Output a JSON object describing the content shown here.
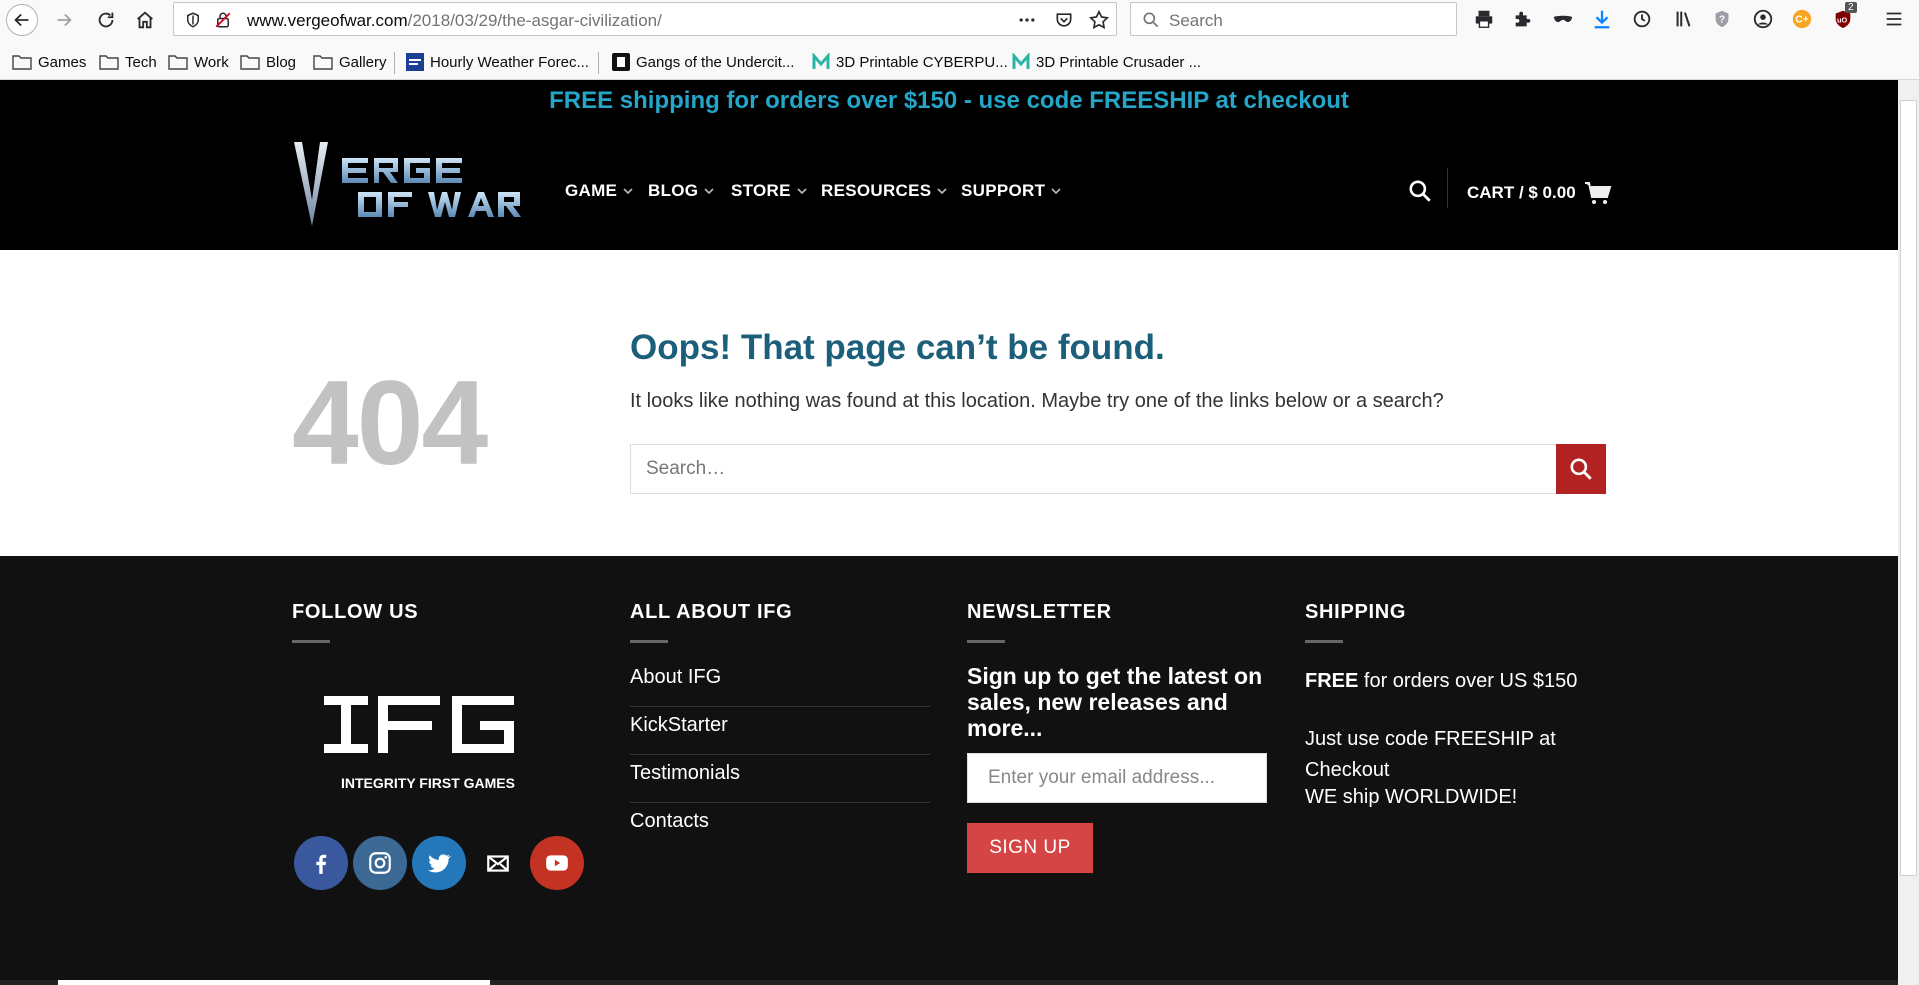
{
  "browser": {
    "url_domain": "www.vergeofwar.com",
    "url_path": "/2018/03/29/the-asgar-civilization/",
    "search_placeholder": "Search",
    "ublock_count": "2",
    "bookmarks": [
      {
        "label": "Games"
      },
      {
        "label": "Tech"
      },
      {
        "label": "Work"
      },
      {
        "label": "Blog"
      },
      {
        "label": "Gallery"
      },
      {
        "label": "Hourly Weather Forec..."
      },
      {
        "label": "Gangs of the Undercit..."
      },
      {
        "label": "3D Printable CYBERPU..."
      },
      {
        "label": "3D Printable Crusader ..."
      }
    ]
  },
  "site": {
    "promo": "FREE shipping for orders over $150 - use code FREESHIP at checkout",
    "logo_alt": "VERGE OF WAR",
    "menu": [
      {
        "label": "GAME"
      },
      {
        "label": "BLOG"
      },
      {
        "label": "STORE"
      },
      {
        "label": "RESOURCES"
      },
      {
        "label": "SUPPORT"
      }
    ],
    "cart_label": "CART / $ 0.00"
  },
  "error": {
    "code": "404",
    "title": "Oops! That page can’t be found.",
    "message": "It looks like nothing was found at this location. Maybe try one of the links below or a search?",
    "search_placeholder": "Search…"
  },
  "footer": {
    "follow_heading": "FOLLOW US",
    "ifg_caption": "INTEGRITY FIRST GAMES",
    "about_heading": "ALL ABOUT IFG",
    "about_links": [
      {
        "label": "About IFG"
      },
      {
        "label": "KickStarter"
      },
      {
        "label": "Testimonials"
      },
      {
        "label": "Contacts"
      }
    ],
    "newsletter_heading": "NEWSLETTER",
    "newsletter_text": "Sign up to get the latest on sales, new releases and more...",
    "email_placeholder": "Enter your email address...",
    "signup_label": "SIGN UP",
    "shipping_heading": "SHIPPING",
    "shipping_free_bold": "FREE",
    "shipping_free_rest": " for orders over US $150",
    "shipping_code": "Just use code FREESHIP at Checkout",
    "shipping_worldwide": "WE ship WORLDWIDE!"
  },
  "colors": {
    "promo_text": "#24a6c9",
    "title_text": "#1c5f7a",
    "search_button": "#b22222",
    "signup_button": "#d64545",
    "facebook": "#3a589d",
    "instagram": "#3b6994",
    "twitter": "#2478ba",
    "youtube": "#c33223"
  }
}
